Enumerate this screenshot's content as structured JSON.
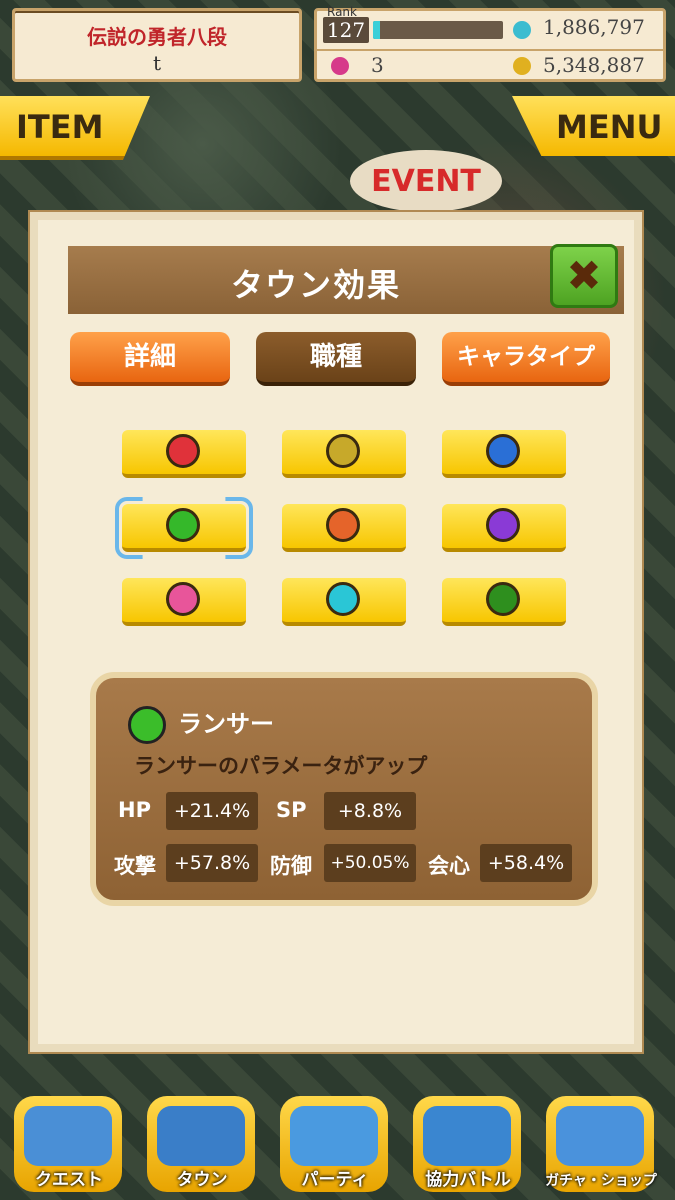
{
  "header": {
    "player_title": "伝説の勇者八段",
    "player_name": "t",
    "rank_label": "Rank",
    "rank": "127",
    "rank_progress": 0.05,
    "stamina": "1,886,797",
    "gems": "3",
    "gold": "5,348,887"
  },
  "buttons": {
    "item": "ITEM",
    "menu": "MENU",
    "event": "EVENT"
  },
  "modal": {
    "title": "タウン効果",
    "close": "✖",
    "tabs": [
      "詳細",
      "職種",
      "キャラタイプ"
    ],
    "active_tab": "職種"
  },
  "jobs": [
    {
      "icon": "sword-icon",
      "color": "#e0323a",
      "glyph": "⚔"
    },
    {
      "icon": "fist-icon",
      "color": "#c7a92a",
      "glyph": "✊"
    },
    {
      "icon": "axe-icon",
      "color": "#2a6fd6",
      "glyph": "🪓"
    },
    {
      "icon": "lance-icon",
      "color": "#35b82a",
      "glyph": "➤"
    },
    {
      "icon": "bow-icon",
      "color": "#e5642a",
      "glyph": "🏹"
    },
    {
      "icon": "staff-icon",
      "color": "#8a3ad6",
      "glyph": "✦"
    },
    {
      "icon": "dagger-icon",
      "color": "#e8559a",
      "glyph": "✂"
    },
    {
      "icon": "magic-icon",
      "color": "#2ac6d6",
      "glyph": "✶"
    },
    {
      "icon": "support-icon",
      "color": "#2e8f1e",
      "glyph": "✿"
    }
  ],
  "selected_job": 3,
  "info": {
    "name": "ランサー",
    "description": "ランサーのパラメータがアップ",
    "hp_label": "HP",
    "hp": "+21.4%",
    "sp_label": "SP",
    "sp": "+8.8%",
    "atk_label": "攻撃",
    "atk": "+57.8%",
    "def_label": "防御",
    "def": "+50.05%",
    "crit_label": "会心",
    "crit": "+58.4%"
  },
  "nav": [
    {
      "label": "クエスト",
      "color": "#4a8fd6"
    },
    {
      "label": "タウン",
      "color": "#3a7ec8"
    },
    {
      "label": "パーティ",
      "color": "#4a9ae0"
    },
    {
      "label": "協力バトル",
      "color": "#3a86d0"
    },
    {
      "label": "ガチャ・ショップ",
      "color": "#4a92dc"
    }
  ]
}
